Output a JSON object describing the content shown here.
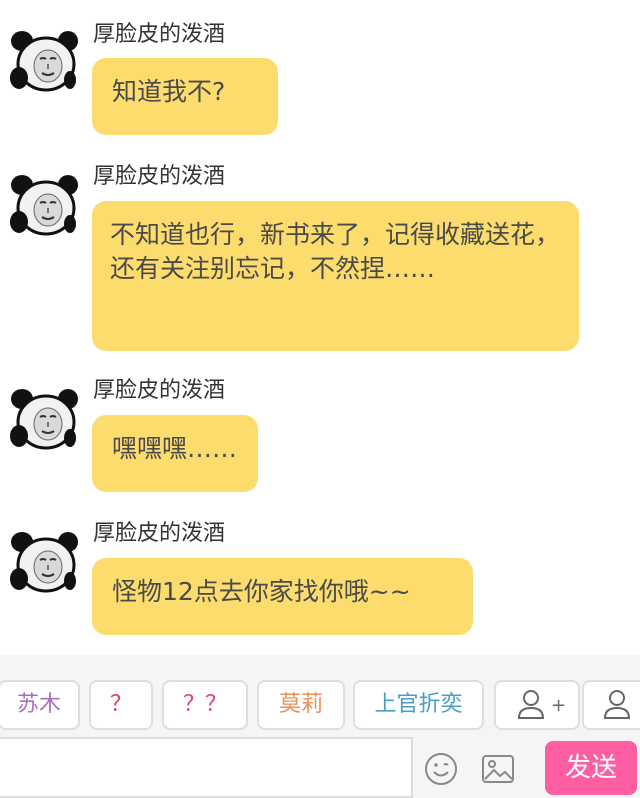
{
  "messages": [
    {
      "sender": "厚脸皮的泼酒",
      "text": "知道我不?"
    },
    {
      "sender": "厚脸皮的泼酒",
      "text": "不知道也行，新书来了，记得收藏送花，还有关注别忘记，不然捏……"
    },
    {
      "sender": "厚脸皮的泼酒",
      "text": "嘿嘿嘿……"
    },
    {
      "sender": "厚脸皮的泼酒",
      "text": "怪物12点去你家找你哦~~"
    }
  ],
  "quick_replies": [
    {
      "label": "苏木",
      "color": "#a86fc4"
    },
    {
      "label": "？",
      "color": "#e0404a"
    },
    {
      "label": "？？",
      "color": "#e0407a"
    },
    {
      "label": "莫莉",
      "color": "#e8905a"
    },
    {
      "label": "上官折奕",
      "color": "#4a9ec4"
    }
  ],
  "add_contact_glyph": "+",
  "input": {
    "placeholder": ""
  },
  "send_label": "发送",
  "icons": {
    "avatar": "panda-meme-avatar-icon",
    "add_contact": "person-add-icon",
    "contact": "person-icon",
    "emoji": "emoji-icon",
    "image": "image-icon"
  },
  "colors": {
    "bubble": "#fddc6e",
    "send_button": "#ff5fa2",
    "toolbar_bg": "#f5f5f5"
  }
}
